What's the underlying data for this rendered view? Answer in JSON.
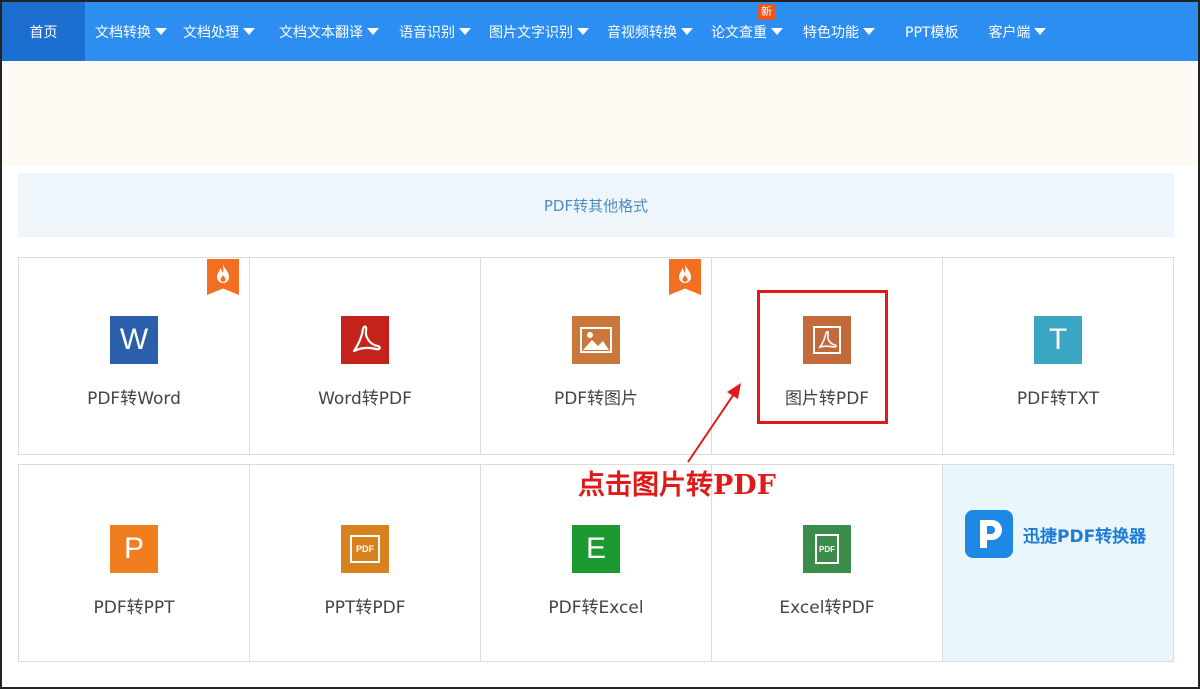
{
  "nav": {
    "items": [
      {
        "label": "首页",
        "active": true,
        "dropdown": false
      },
      {
        "label": "文档转换",
        "dropdown": true
      },
      {
        "label": "文档处理",
        "dropdown": true
      },
      {
        "label": "文档文本翻译",
        "dropdown": true
      },
      {
        "label": "语音识别",
        "dropdown": true
      },
      {
        "label": "图片文字识别",
        "dropdown": true
      },
      {
        "label": "音视频转换",
        "dropdown": true
      },
      {
        "label": "论文查重",
        "dropdown": true,
        "badge": "新"
      },
      {
        "label": "特色功能",
        "dropdown": true
      },
      {
        "label": "PPT模板",
        "dropdown": false
      },
      {
        "label": "客户端",
        "dropdown": true
      }
    ]
  },
  "section": {
    "title": "PDF转其他格式"
  },
  "tools": {
    "row1": [
      {
        "label": "PDF转Word",
        "icon": "word-icon",
        "glyph": "W",
        "color": "#2b5eab",
        "hot": true
      },
      {
        "label": "Word转PDF",
        "icon": "pdf-acrobat-icon",
        "glyph": "",
        "color": "#c4231b",
        "hot": false
      },
      {
        "label": "PDF转图片",
        "icon": "image-icon",
        "glyph": "",
        "color": "#c9773a",
        "hot": true
      },
      {
        "label": "图片转PDF",
        "icon": "pdf-acrobat-icon",
        "glyph": "",
        "color": "#c26a3c",
        "hot": false
      },
      {
        "label": "PDF转TXT",
        "icon": "txt-icon",
        "glyph": "T",
        "color": "#3aa6c4",
        "hot": false
      }
    ],
    "row2": [
      {
        "label": "PDF转PPT",
        "icon": "ppt-icon",
        "glyph": "P",
        "color": "#f07d1e"
      },
      {
        "label": "PPT转PDF",
        "icon": "pdf-doc-icon",
        "glyph": "PDF",
        "color": "#d8821e"
      },
      {
        "label": "PDF转Excel",
        "icon": "excel-icon",
        "glyph": "E",
        "color": "#1d9a2f"
      },
      {
        "label": "Excel转PDF",
        "icon": "pdf-doc-icon",
        "glyph": "PDF",
        "color": "#3b8c4a"
      }
    ]
  },
  "promo": {
    "text": "迅捷PDF转换器"
  },
  "annotation": {
    "text": "点击图片转PDF",
    "color": "#e01919"
  }
}
